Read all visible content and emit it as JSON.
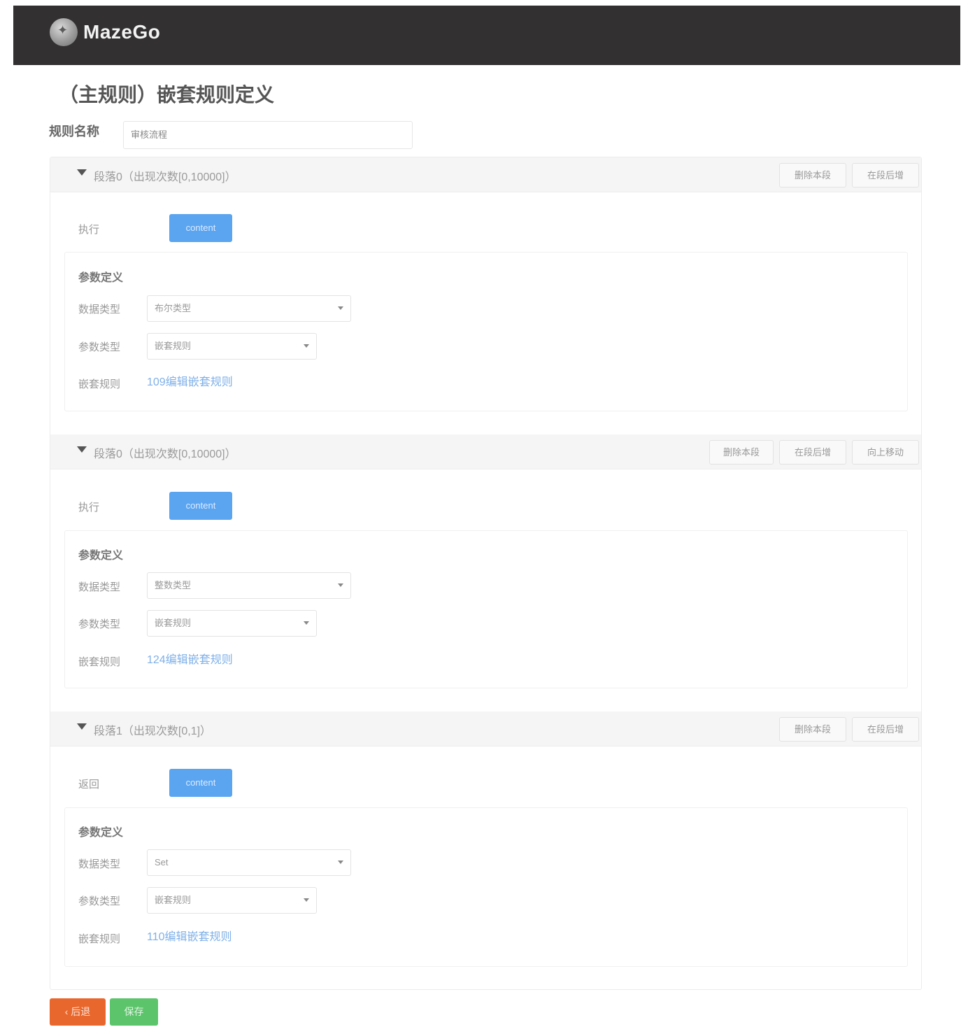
{
  "app": {
    "brand": "MazeGo"
  },
  "page": {
    "title": "（主规则）嵌套规则定义",
    "rule_name_label": "规则名称",
    "rule_name_value": "审核流程"
  },
  "segments": [
    {
      "title": "段落0（出现次数[0,10000]）",
      "buttons": [
        "删除本段",
        "在段后增"
      ],
      "action_label": "执行",
      "action_button": "content",
      "param_title": "参数定义",
      "data_type_label": "数据类型",
      "data_type_value": "布尔类型",
      "param_type_label": "参数类型",
      "param_type_value": "嵌套规则",
      "nested_label": "嵌套规则",
      "nested_link": "109编辑嵌套规则"
    },
    {
      "title": "段落0（出现次数[0,10000]）",
      "buttons": [
        "删除本段",
        "在段后增",
        "向上移动"
      ],
      "action_label": "执行",
      "action_button": "content",
      "param_title": "参数定义",
      "data_type_label": "数据类型",
      "data_type_value": "整数类型",
      "param_type_label": "参数类型",
      "param_type_value": "嵌套规则",
      "nested_label": "嵌套规则",
      "nested_link": "124编辑嵌套规则"
    },
    {
      "title": "段落1（出现次数[0,1]）",
      "buttons": [
        "删除本段",
        "在段后增"
      ],
      "action_label": "返回",
      "action_button": "content",
      "param_title": "参数定义",
      "data_type_label": "数据类型",
      "data_type_value": "Set",
      "param_type_label": "参数类型",
      "param_type_value": "嵌套规则",
      "nested_label": "嵌套规则",
      "nested_link": "110编辑嵌套规则"
    }
  ],
  "footer": {
    "back_label": "‹ 后退",
    "save_label": "保存"
  },
  "colors": {
    "topbar": "#323030",
    "primary": "#5aa4f0",
    "back": "#e8672d",
    "save": "#5cc46b",
    "link": "#7fb0e8"
  }
}
